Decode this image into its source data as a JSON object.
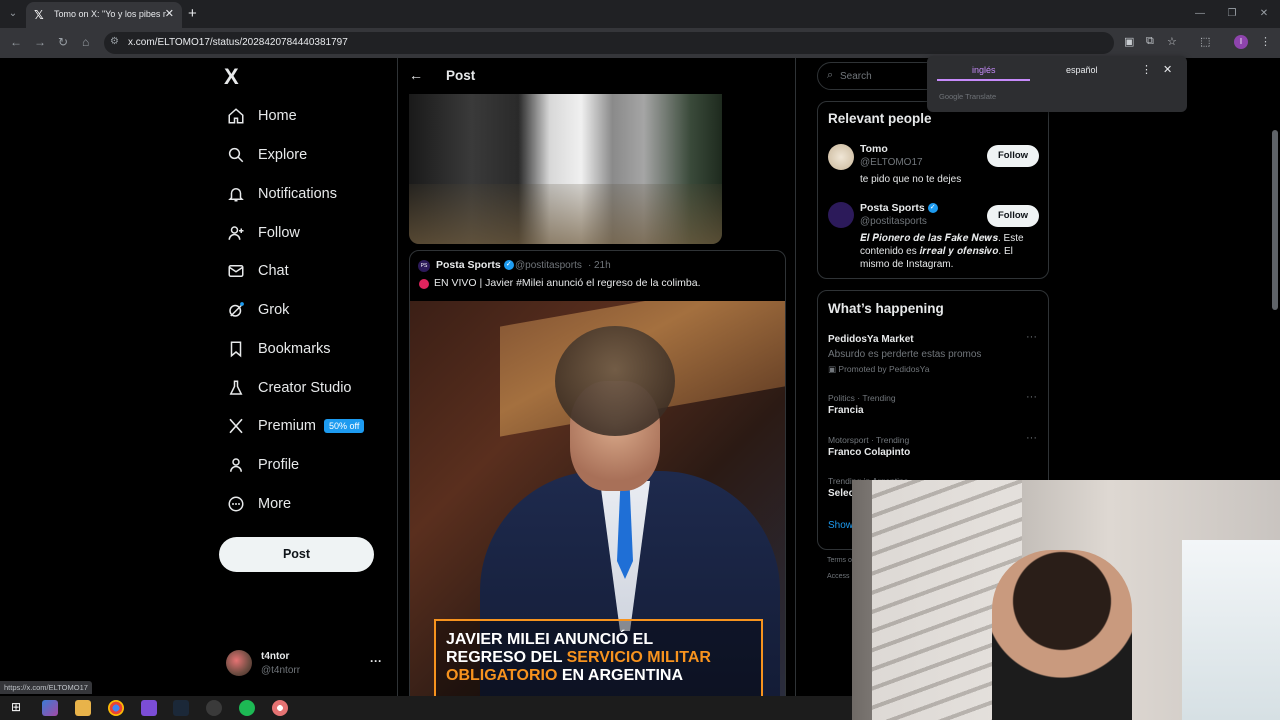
{
  "browser": {
    "tab_title": "Tomo on X: \"Yo y los pibes mañ",
    "tab_close": "✕",
    "new_tab": "+",
    "url": "x.com/ELTOMO17/status/2028420784440381797",
    "profile_initial": "I",
    "status_url": "https://x.com/ELTOMO17"
  },
  "translate": {
    "source_lang": "inglés",
    "target_lang": "español",
    "brand": "Google Translate"
  },
  "sidebar": {
    "logo": "X",
    "items": [
      {
        "label": "Home",
        "icon": "home-icon"
      },
      {
        "label": "Explore",
        "icon": "search-icon"
      },
      {
        "label": "Notifications",
        "icon": "bell-icon"
      },
      {
        "label": "Follow",
        "icon": "person-add-icon"
      },
      {
        "label": "Chat",
        "icon": "envelope-icon"
      },
      {
        "label": "Grok",
        "icon": "grok-icon"
      },
      {
        "label": "Bookmarks",
        "icon": "bookmark-icon"
      },
      {
        "label": "Creator Studio",
        "icon": "flask-icon"
      },
      {
        "label": "Premium",
        "icon": "x-icon",
        "badge": "50% off"
      },
      {
        "label": "Profile",
        "icon": "person-icon"
      },
      {
        "label": "More",
        "icon": "more-circle-icon"
      }
    ],
    "post_button": "Post",
    "account": {
      "name": "t4ntor",
      "handle": "@t4ntorr"
    }
  },
  "main": {
    "header_title": "Post",
    "quote": {
      "author": "Posta Sports",
      "handle": "@postitasports",
      "separator": "·",
      "time": "21h",
      "text": "EN VIVO | Javier #Milei anunció el regreso de la colimba.",
      "banner": {
        "line1": "JAVIER MILEI ANUNCIÓ EL",
        "line2_white": "REGRESO DEL ",
        "line2_orange": "SERVICIO MILITAR",
        "line3_orange": "OBLIGATORIO",
        "line3_white": " EN ARGENTINA"
      }
    }
  },
  "right": {
    "search_placeholder": "Search",
    "relevant_people": {
      "title": "Relevant people",
      "people": [
        {
          "name": "Tomo",
          "handle": "@ELTOMO17",
          "bio": "te pido que no te dejes",
          "follow": "Follow"
        },
        {
          "name": "Posta Sports",
          "handle": "@postitasports",
          "bio_line1": "𝑬𝒍 𝑷𝒊𝒐𝒏𝒆𝒓𝒐 𝒅𝒆 𝒍𝒂𝒔 𝑭𝒂𝒌𝒆 𝑵𝒆𝒘𝒔. Este",
          "bio_line2": "contenido es 𝒊𝒓𝒓𝒆𝒂𝒍 𝒚 𝒐𝒇𝒆𝒏𝒔𝒊𝒗𝒐. El",
          "bio_line3": "mismo de Instagram.",
          "follow": "Follow"
        }
      ]
    },
    "happening": {
      "title": "What’s happening",
      "trends": [
        {
          "meta": "",
          "name": "PedidosYa Market",
          "sub": "Absurdo es perderte estas promos",
          "promo": "Promoted by PedidosYa"
        },
        {
          "meta": "Politics · Trending",
          "name": "Francia"
        },
        {
          "meta": "Motorsport · Trending",
          "name": "Franco Colapinto"
        },
        {
          "meta": "Trending in Argentina",
          "name": "Selec"
        }
      ],
      "show_more": "Show"
    },
    "footer1": "Terms o",
    "footer2": "Access"
  },
  "colors": {
    "accent": "#1d9bf0",
    "banner_orange": "#f7931e",
    "live_red": "#e0245e",
    "translate_purple": "#c58af9"
  }
}
